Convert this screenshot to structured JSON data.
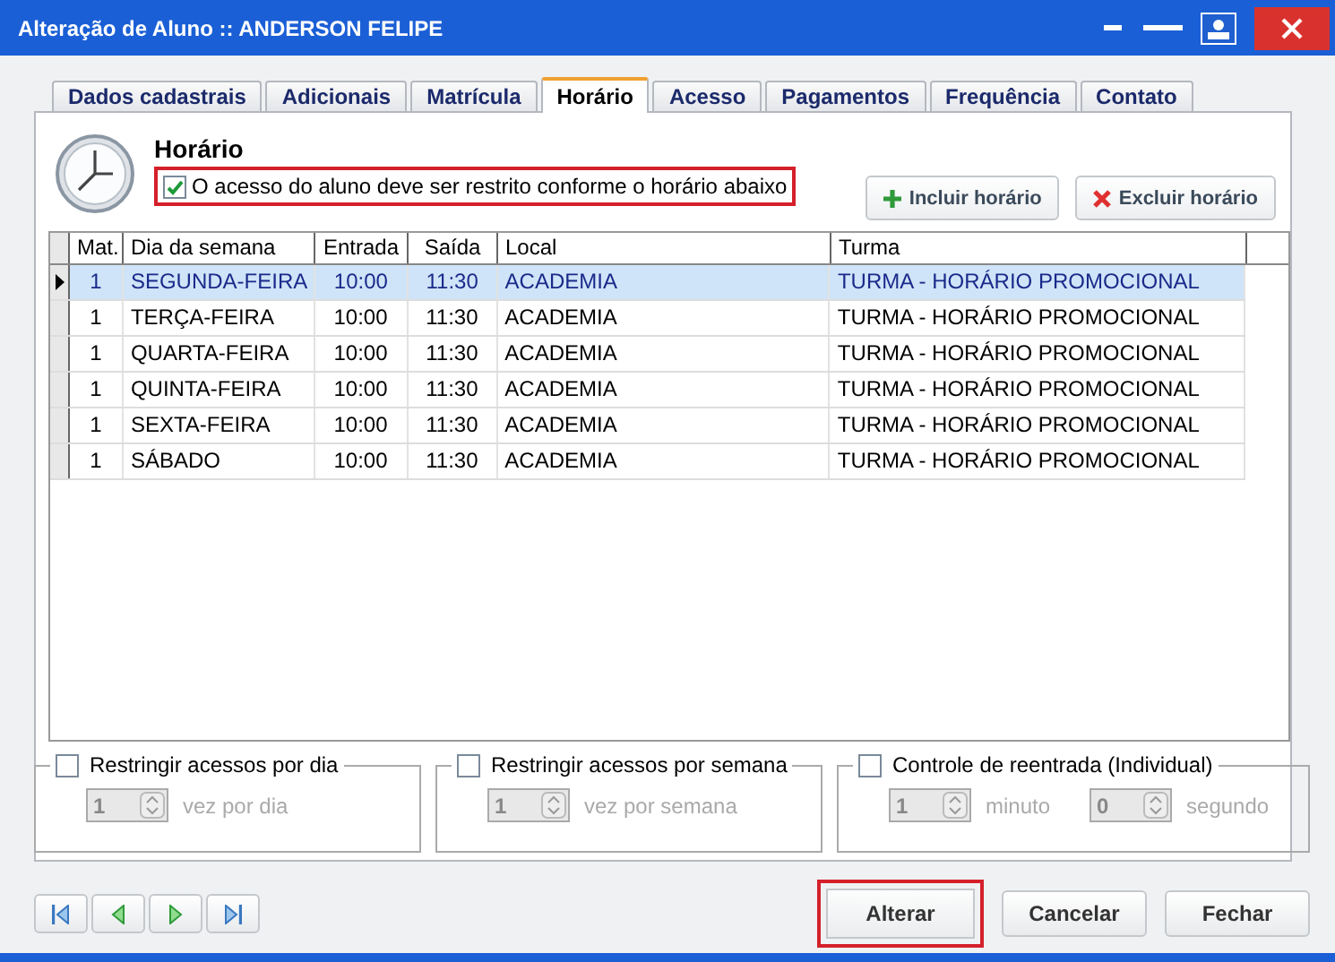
{
  "window": {
    "title": "Alteração de Aluno :: ANDERSON FELIPE"
  },
  "tabs": [
    {
      "label": "Dados cadastrais",
      "selected": false
    },
    {
      "label": "Adicionais",
      "selected": false
    },
    {
      "label": "Matrícula",
      "selected": false
    },
    {
      "label": "Horário",
      "selected": true
    },
    {
      "label": "Acesso",
      "selected": false
    },
    {
      "label": "Pagamentos",
      "selected": false
    },
    {
      "label": "Frequência",
      "selected": false
    },
    {
      "label": "Contato",
      "selected": false
    }
  ],
  "section": {
    "title": "Horário",
    "restrict": {
      "label": "O acesso do aluno deve ser restrito conforme o horário abaixo",
      "checked": true,
      "highlighted": true
    }
  },
  "actions": [
    {
      "kind": "add",
      "label": "Incluir horário"
    },
    {
      "kind": "remove",
      "label": "Excluir horário"
    }
  ],
  "table": {
    "columns": [
      "Mat.",
      "Dia da semana",
      "Entrada",
      "Saída",
      "Local",
      "Turma"
    ],
    "rows": [
      {
        "cells": [
          "1",
          "SEGUNDA-FEIRA",
          "10:00",
          "11:30",
          "ACADEMIA",
          "TURMA - HORÁRIO PROMOCIONAL"
        ],
        "selected": true
      },
      {
        "cells": [
          "1",
          "TERÇA-FEIRA",
          "10:00",
          "11:30",
          "ACADEMIA",
          "TURMA - HORÁRIO PROMOCIONAL"
        ],
        "selected": false
      },
      {
        "cells": [
          "1",
          "QUARTA-FEIRA",
          "10:00",
          "11:30",
          "ACADEMIA",
          "TURMA - HORÁRIO PROMOCIONAL"
        ],
        "selected": false
      },
      {
        "cells": [
          "1",
          "QUINTA-FEIRA",
          "10:00",
          "11:30",
          "ACADEMIA",
          "TURMA - HORÁRIO PROMOCIONAL"
        ],
        "selected": false
      },
      {
        "cells": [
          "1",
          "SEXTA-FEIRA",
          "10:00",
          "11:30",
          "ACADEMIA",
          "TURMA - HORÁRIO PROMOCIONAL"
        ],
        "selected": false
      },
      {
        "cells": [
          "1",
          "SÁBADO",
          "10:00",
          "11:30",
          "ACADEMIA",
          "TURMA - HORÁRIO PROMOCIONAL"
        ],
        "selected": false
      }
    ]
  },
  "limits": [
    {
      "label": "Restringir acessos por dia",
      "checked": false,
      "fields": [
        {
          "value": "1",
          "unit": "vez por dia",
          "disabled": true
        }
      ]
    },
    {
      "label": "Restringir acessos por semana",
      "checked": false,
      "fields": [
        {
          "value": "1",
          "unit": "vez por semana",
          "disabled": true
        }
      ]
    },
    {
      "label": "Controle de reentrada (Individual)",
      "checked": false,
      "fields": [
        {
          "value": "1",
          "unit": "minuto",
          "disabled": true
        },
        {
          "value": "0",
          "unit": "segundo",
          "disabled": true
        }
      ]
    }
  ],
  "navigation": [
    {
      "kind": "first"
    },
    {
      "kind": "previous"
    },
    {
      "kind": "next"
    },
    {
      "kind": "last"
    }
  ],
  "buttons": [
    {
      "label": "Alterar",
      "highlighted": true
    },
    {
      "label": "Cancelar",
      "highlighted": false
    },
    {
      "label": "Fechar",
      "highlighted": false
    }
  ]
}
